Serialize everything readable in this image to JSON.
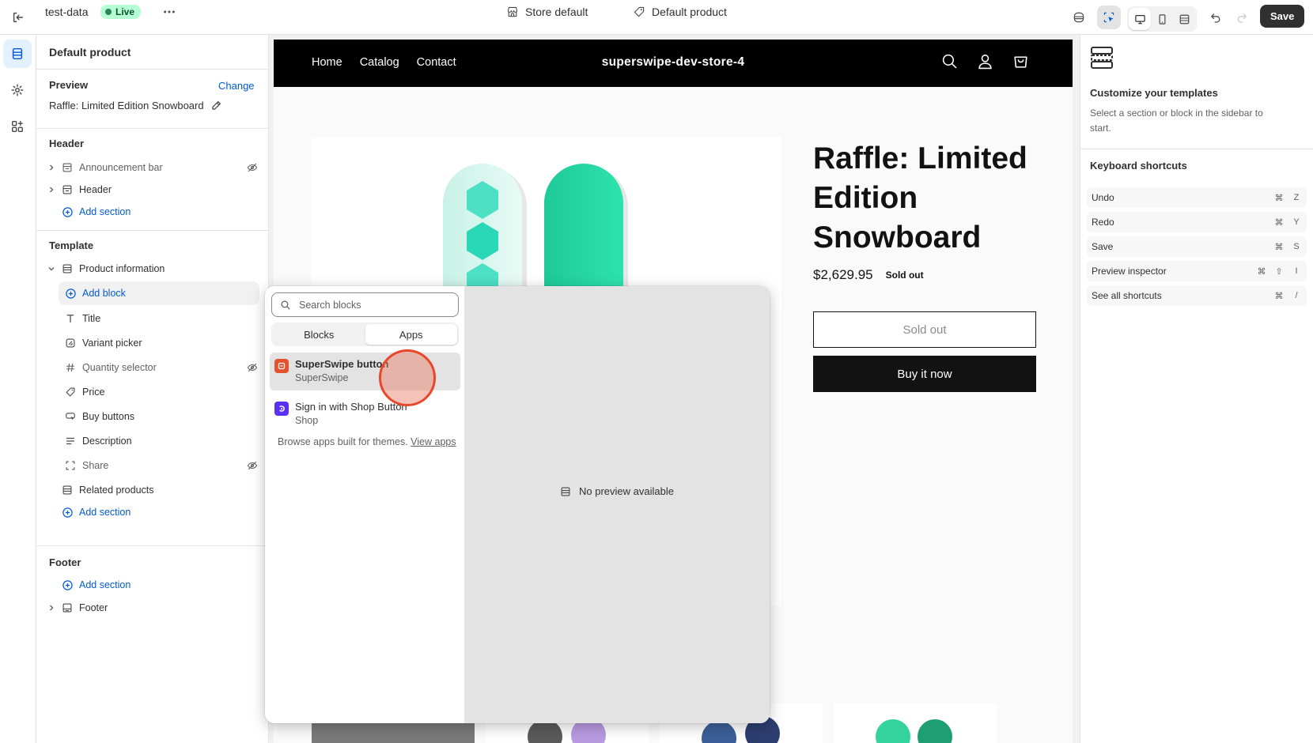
{
  "topbar": {
    "store_name": "test-data",
    "live_label": "Live",
    "theme_label": "Store default",
    "template_label": "Default product",
    "save_label": "Save"
  },
  "sidebar": {
    "title": "Default product",
    "preview_label": "Preview",
    "change_label": "Change",
    "preview_product": "Raffle: Limited Edition Snowboard",
    "header_group": "Header",
    "header_items": [
      "Announcement bar",
      "Header"
    ],
    "add_section": "Add section",
    "template_group": "Template",
    "product_information": "Product information",
    "add_block": "Add block",
    "blocks": [
      "Title",
      "Variant picker",
      "Quantity selector",
      "Price",
      "Buy buttons",
      "Description",
      "Share"
    ],
    "related_products": "Related products",
    "footer_group": "Footer",
    "footer_item": "Footer"
  },
  "picker": {
    "search_placeholder": "Search blocks",
    "tabs": [
      "Blocks",
      "Apps"
    ],
    "apps": [
      {
        "name": "SuperSwipe button",
        "vendor": "SuperSwipe",
        "color": "#e5522f"
      },
      {
        "name": "Sign in with Shop Button",
        "vendor": "Shop",
        "color": "#5a31f4"
      }
    ],
    "browse_text": "Browse apps built for themes.",
    "view_apps": "View apps",
    "no_preview": "No preview available"
  },
  "store": {
    "nav": [
      "Home",
      "Catalog",
      "Contact"
    ],
    "logo": "superswipe-dev-store-4",
    "product_title": "Raffle: Limited Edition Snowboard",
    "price": "$2,629.95",
    "sold_out_badge": "Sold out",
    "sold_out_button": "Sold out",
    "buy_now": "Buy it now"
  },
  "right_panel": {
    "title": "Customize your templates",
    "description": "Select a section or block in the sidebar to start.",
    "shortcuts_title": "Keyboard shortcuts",
    "shortcuts": [
      {
        "label": "Undo",
        "keys": [
          "⌘",
          "Z"
        ]
      },
      {
        "label": "Redo",
        "keys": [
          "⌘",
          "Y"
        ]
      },
      {
        "label": "Save",
        "keys": [
          "⌘",
          "S"
        ]
      },
      {
        "label": "Preview inspector",
        "keys": [
          "⌘",
          "⇧",
          "I"
        ]
      },
      {
        "label": "See all shortcuts",
        "keys": [
          "⌘",
          "/"
        ]
      }
    ]
  },
  "colors": {
    "accent": "#005bd3",
    "live_bg": "#b4fed2",
    "cursor": "#e8472b"
  }
}
